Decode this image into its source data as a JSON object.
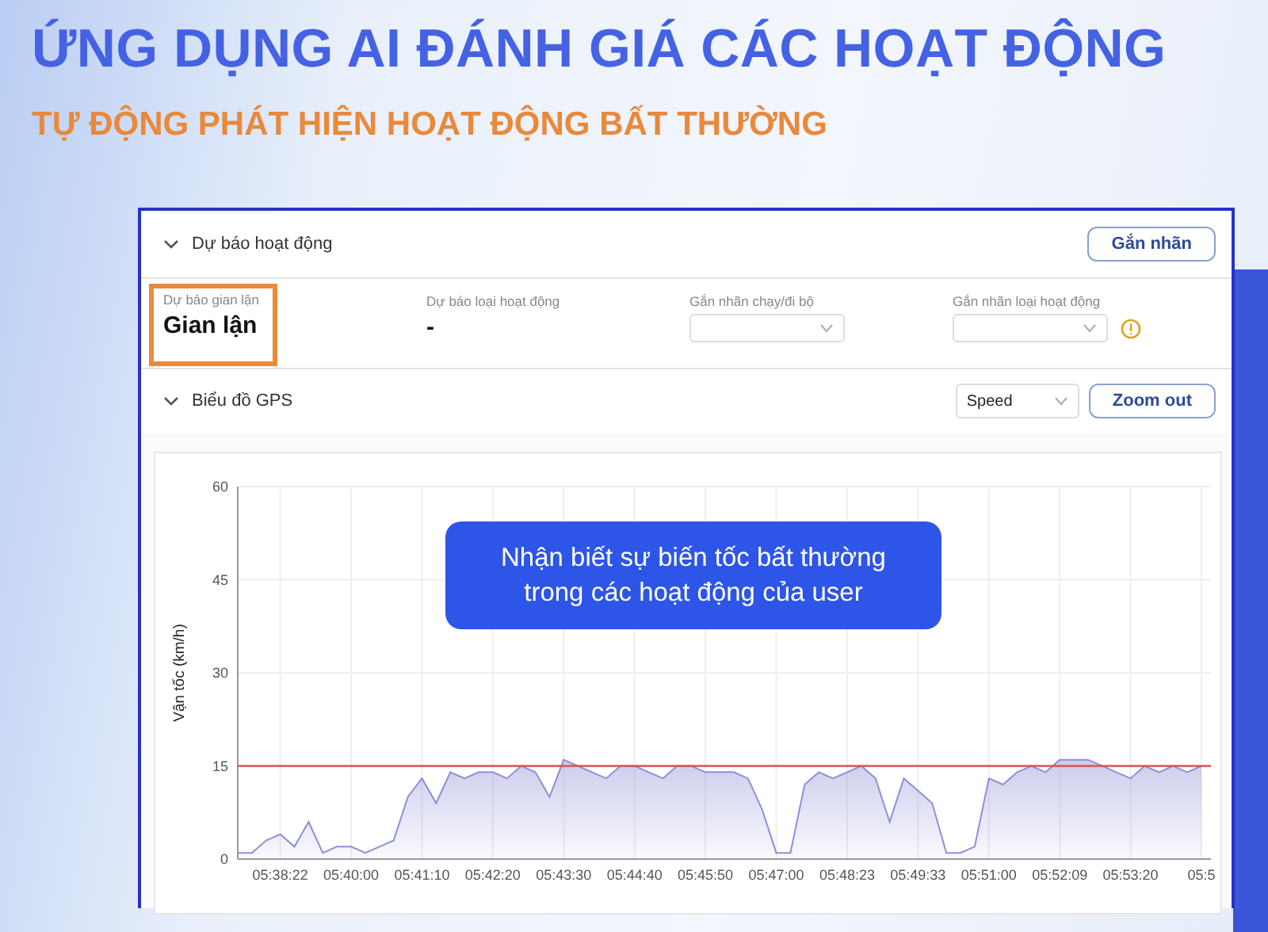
{
  "title": "ỨNG DỤNG AI ĐÁNH GIÁ CÁC HOẠT ĐỘNG",
  "subtitle": "TỰ ĐỘNG PHÁT HIỆN HOẠT ĐỘNG BẤT THƯỜNG",
  "activity_section": {
    "title": "Dự báo hoạt động",
    "expanded": true,
    "button": "Gắn nhãn",
    "fields": [
      {
        "kind": "value",
        "label": "Dự báo gian lận",
        "value": "Gian lận",
        "highlighted": true
      },
      {
        "kind": "value",
        "label": "Dự báo loại hoạt động",
        "value": "-",
        "highlighted": false
      },
      {
        "kind": "select",
        "label": "Gắn nhãn chạy/đi bộ",
        "info": false
      },
      {
        "kind": "select",
        "label": "Gắn nhãn loại hoạt động",
        "info": true
      }
    ]
  },
  "gps_section": {
    "title": "Biểu đồ GPS",
    "expanded": true,
    "select_value": "Speed",
    "button": "Zoom out",
    "callout": [
      "Nhận biết sự biến tốc bất thường",
      "trong các hoạt động của user"
    ],
    "chart_data": {
      "type": "area",
      "grid": true,
      "ylabel": "Vận tốc (km/h)",
      "ylim": [
        0,
        60
      ],
      "yticks": [
        0,
        15,
        30,
        45,
        60
      ],
      "categories": [
        null,
        null,
        null,
        "05:38:22",
        null,
        null,
        null,
        null,
        "05:40:00",
        null,
        null,
        null,
        null,
        "05:41:10",
        null,
        null,
        null,
        null,
        "05:42:20",
        null,
        null,
        null,
        null,
        "05:43:30",
        null,
        null,
        null,
        null,
        "05:44:40",
        null,
        null,
        null,
        null,
        "05:45:50",
        null,
        null,
        null,
        null,
        "05:47:00",
        null,
        null,
        null,
        null,
        "05:48:23",
        null,
        null,
        null,
        null,
        "05:49:33",
        null,
        null,
        null,
        null,
        "05:51:00",
        null,
        null,
        null,
        null,
        "05:52:09",
        null,
        null,
        null,
        null,
        "05:53:20",
        null,
        null,
        null,
        null,
        "05:5"
      ],
      "series": [
        {
          "color": "#8f8fd8",
          "values": [
            1,
            1,
            3,
            4,
            2,
            6,
            1,
            2,
            2,
            1,
            2,
            3,
            10,
            13,
            9,
            14,
            13,
            14,
            14,
            13,
            15,
            14,
            10,
            16,
            15,
            14,
            13,
            15,
            15,
            14,
            13,
            15,
            15,
            14,
            14,
            14,
            13,
            8,
            1,
            1,
            12,
            14,
            13,
            14,
            15,
            13,
            6,
            13,
            11,
            9,
            1,
            1,
            2,
            13,
            12,
            14,
            15,
            14,
            16,
            16,
            16,
            15,
            14,
            13,
            15,
            14,
            15,
            14,
            15
          ]
        }
      ],
      "ref_lines": [
        {
          "axis": "y",
          "value": 15,
          "color": "#e05050"
        }
      ]
    }
  }
}
